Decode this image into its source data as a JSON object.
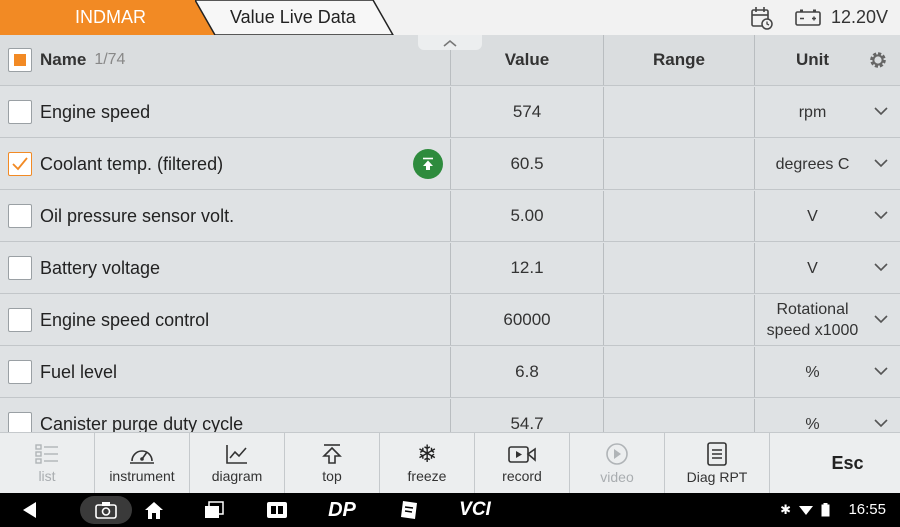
{
  "header": {
    "brand_tab": "INDMAR",
    "page_tab": "Value Live Data",
    "voltage": "12.20V"
  },
  "table": {
    "columns": {
      "name": "Name",
      "count": "1/74",
      "value": "Value",
      "range": "Range",
      "unit": "Unit"
    },
    "rows": [
      {
        "name": "Engine speed",
        "value": "574",
        "range": "",
        "unit": "rpm",
        "checked": false
      },
      {
        "name": "Coolant temp. (filtered)",
        "value": "60.5",
        "range": "",
        "unit": "degrees C",
        "checked": true
      },
      {
        "name": "Oil pressure sensor volt.",
        "value": "5.00",
        "range": "",
        "unit": "V",
        "checked": false
      },
      {
        "name": "Battery voltage",
        "value": "12.1",
        "range": "",
        "unit": "V",
        "checked": false
      },
      {
        "name": "Engine speed control",
        "value": "60000",
        "range": "",
        "unit": "Rotational speed x1000",
        "checked": false
      },
      {
        "name": "Fuel level",
        "value": "6.8",
        "range": "",
        "unit": "%",
        "checked": false
      },
      {
        "name": "Canister purge duty cycle",
        "value": "54.7",
        "range": "",
        "unit": "%",
        "checked": false
      }
    ]
  },
  "toolbar": {
    "list": "list",
    "instrument": "instrument",
    "diagram": "diagram",
    "top": "top",
    "freeze": "freeze",
    "record": "record",
    "video": "video",
    "diag_rpt": "Diag RPT",
    "esc": "Esc"
  },
  "system": {
    "clock": "16:55",
    "vci": "VCI",
    "dp": "DP"
  },
  "colors": {
    "accent": "#f28a24",
    "badge_green": "#2e8b3d"
  }
}
